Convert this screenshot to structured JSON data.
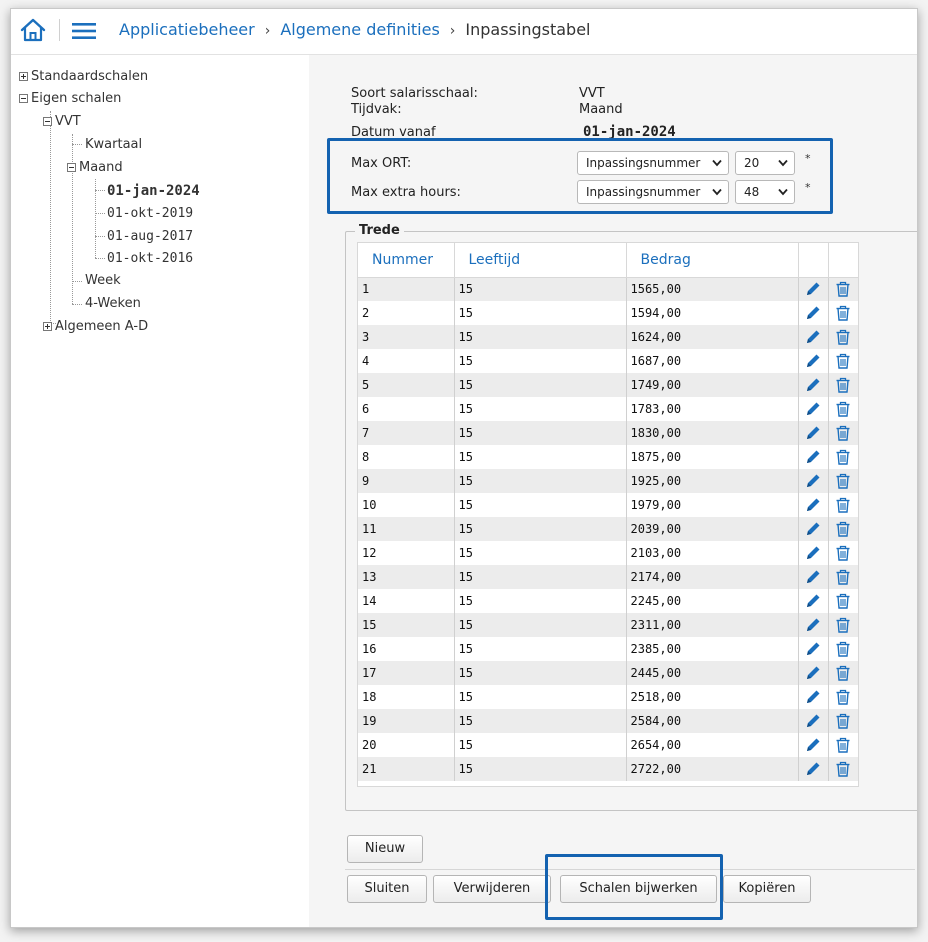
{
  "header": {
    "breadcrumb": [
      "Applicatiebeheer",
      "Algemene definities"
    ],
    "current": "Inpassingstabel",
    "separator": "›"
  },
  "tree": {
    "standaardschalen": "Standaardschalen",
    "eigen_schalen": "Eigen schalen",
    "vvt": "VVT",
    "kwartaal": "Kwartaal",
    "maand": "Maand",
    "dates": [
      "01-jan-2024",
      "01-okt-2019",
      "01-aug-2017",
      "01-okt-2016"
    ],
    "week": "Week",
    "vier_weken": "4-Weken",
    "algemeen": "Algemeen A-D"
  },
  "form": {
    "soort_label": "Soort salarisschaal:",
    "soort_value": "VVT",
    "tijdvak_label": "Tijdvak:",
    "tijdvak_value": "Maand",
    "datum_label": "Datum vanaf",
    "datum_value": "01-jan-2024",
    "max_ort_label": "Max ORT:",
    "max_ort_type": "Inpassingsnummer",
    "max_ort_value": "20",
    "max_extra_label": "Max extra hours:",
    "max_extra_type": "Inpassingsnummer",
    "max_extra_value": "48",
    "required_mark": "*"
  },
  "trede": {
    "legend": "Trede",
    "columns": [
      "Nummer",
      "Leeftijd",
      "Bedrag"
    ],
    "rows": [
      [
        "1",
        "15",
        "1565,00"
      ],
      [
        "2",
        "15",
        "1594,00"
      ],
      [
        "3",
        "15",
        "1624,00"
      ],
      [
        "4",
        "15",
        "1687,00"
      ],
      [
        "5",
        "15",
        "1749,00"
      ],
      [
        "6",
        "15",
        "1783,00"
      ],
      [
        "7",
        "15",
        "1830,00"
      ],
      [
        "8",
        "15",
        "1875,00"
      ],
      [
        "9",
        "15",
        "1925,00"
      ],
      [
        "10",
        "15",
        "1979,00"
      ],
      [
        "11",
        "15",
        "2039,00"
      ],
      [
        "12",
        "15",
        "2103,00"
      ],
      [
        "13",
        "15",
        "2174,00"
      ],
      [
        "14",
        "15",
        "2245,00"
      ],
      [
        "15",
        "15",
        "2311,00"
      ],
      [
        "16",
        "15",
        "2385,00"
      ],
      [
        "17",
        "15",
        "2445,00"
      ],
      [
        "18",
        "15",
        "2518,00"
      ],
      [
        "19",
        "15",
        "2584,00"
      ],
      [
        "20",
        "15",
        "2654,00"
      ],
      [
        "21",
        "15",
        "2722,00"
      ]
    ]
  },
  "buttons": {
    "nieuw": "Nieuw",
    "sluiten": "Sluiten",
    "verwijderen": "Verwijderen",
    "schalen_bijwerken": "Schalen bijwerken",
    "kopieren": "Kopiëren"
  },
  "colors": {
    "accent": "#1b6fbd",
    "highlight": "#1462b0"
  },
  "icons": {
    "home": "home-icon",
    "menu": "hamburger-menu-icon",
    "edit": "pencil-icon",
    "delete": "trash-icon",
    "dropdown": "chevron-down-icon"
  }
}
